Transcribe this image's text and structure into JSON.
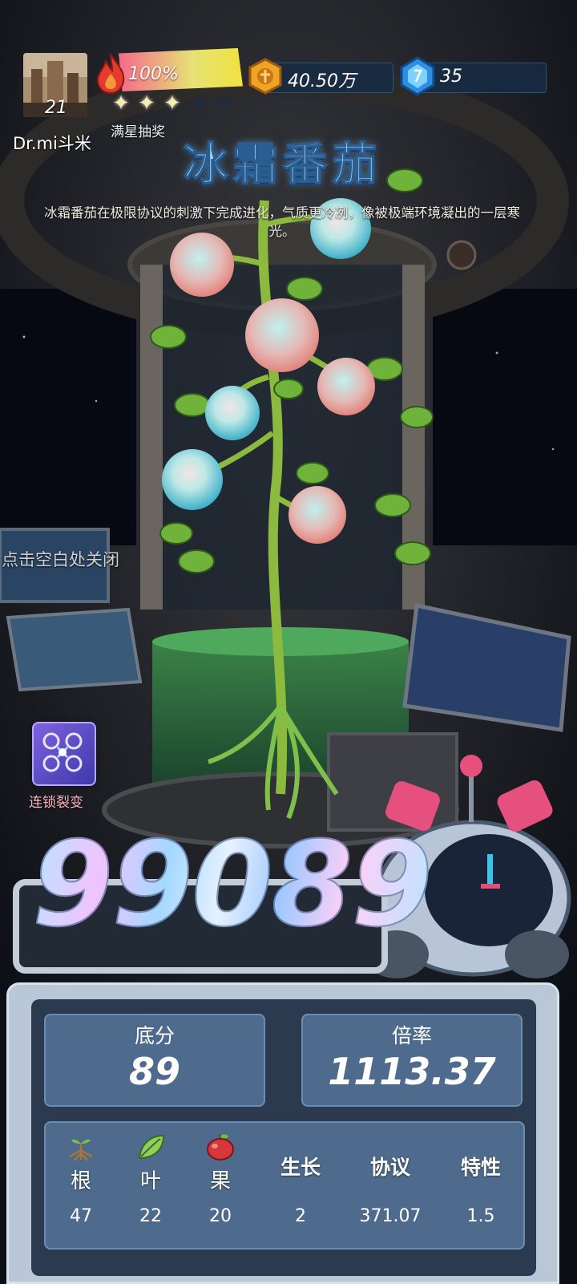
{
  "player": {
    "level": "21",
    "name": "Dr.mi斗米"
  },
  "energy": {
    "percent_label": "100%",
    "fill_fraction": 1.0,
    "stars_filled": 3,
    "stars_total": 5,
    "lottery_label": "满星抽奖"
  },
  "currency": {
    "coins": "40.50万",
    "gems": "35"
  },
  "plant": {
    "title": "冰霜番茄",
    "description": "冰霜番茄在极限协议的刺激下完成进化，气质更冷冽，像被极端环境凝出的一层寒光。"
  },
  "close_hint": "点击空白处关闭",
  "chain_button": {
    "label": "连锁裂变"
  },
  "score": {
    "total": "99089",
    "base_label": "底分",
    "base_value": "89",
    "multiplier_label": "倍率",
    "multiplier_value": "1113.37"
  },
  "attributes": [
    {
      "name": "根",
      "value": "47",
      "icon": "root-icon"
    },
    {
      "name": "叶",
      "value": "22",
      "icon": "leaf-icon"
    },
    {
      "name": "果",
      "value": "20",
      "icon": "apple-icon"
    },
    {
      "name": "生长",
      "value": "2"
    },
    {
      "name": "协议",
      "value": "371.07"
    },
    {
      "name": "特性",
      "value": "1.5"
    }
  ],
  "colors": {
    "title": "#a9d8f3",
    "panel": "#b9c7d6",
    "stat_box": "#4e6b8d",
    "lottery_star": "#f6edb4"
  }
}
